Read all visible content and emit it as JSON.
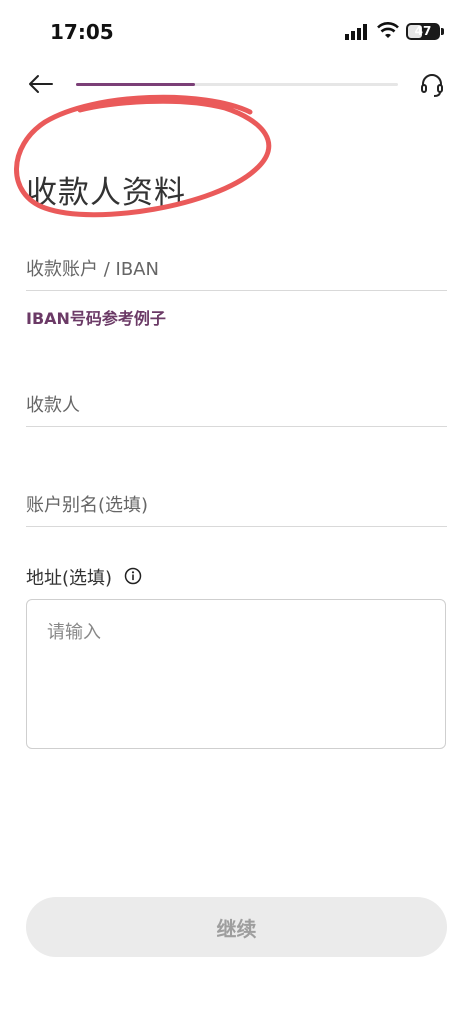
{
  "status_bar": {
    "time": "17:05",
    "battery": "47"
  },
  "header": {
    "progress_percent": 37
  },
  "page": {
    "title": "收款人资料"
  },
  "form": {
    "account_placeholder": "收款账户 / IBAN",
    "iban_example_link": "IBAN号码参考例子",
    "payee_placeholder": "收款人",
    "alias_placeholder": "账户别名(选填)",
    "address_label": "地址(选填)",
    "address_placeholder": "请输入"
  },
  "actions": {
    "continue_label": "继续"
  },
  "colors": {
    "accent": "#7b3f77",
    "annotation": "#ea5a5a",
    "button_bg": "#ebebeb"
  },
  "icons": [
    "back-arrow-icon",
    "headset-icon",
    "info-icon",
    "signal-icon",
    "wifi-icon",
    "battery-icon"
  ]
}
